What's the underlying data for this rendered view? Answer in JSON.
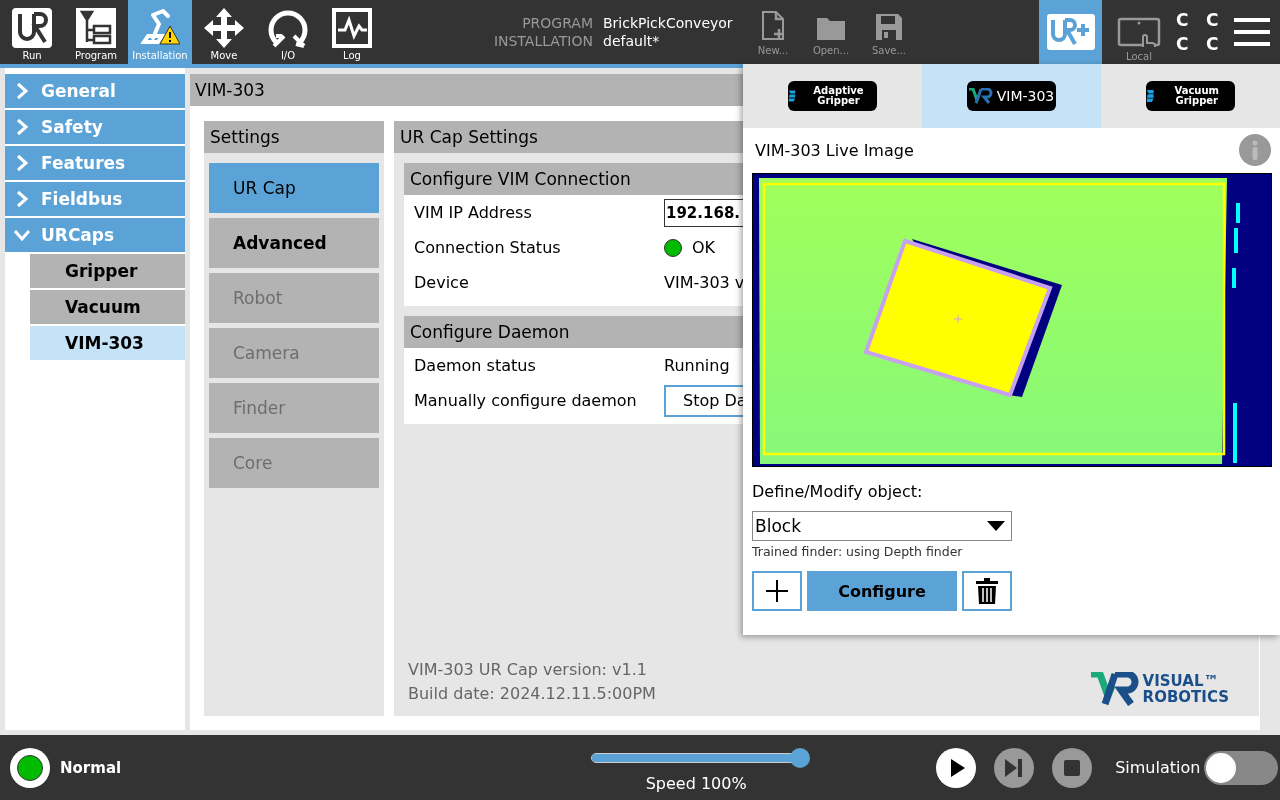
{
  "top_nav": [
    {
      "label": "Run",
      "kind": "run",
      "selected": false
    },
    {
      "label": "Program",
      "kind": "program",
      "selected": false
    },
    {
      "label": "Installation",
      "kind": "installation",
      "selected": true
    },
    {
      "label": "Move",
      "kind": "move",
      "selected": false
    },
    {
      "label": "I/O",
      "kind": "io",
      "selected": false
    },
    {
      "label": "Log",
      "kind": "log",
      "selected": false
    }
  ],
  "program_info": {
    "program_label": "PROGRAM",
    "program_name": "BrickPickConveyor",
    "installation_label": "INSTALLATION",
    "installation_name": "default*"
  },
  "file_buttons": [
    {
      "label": "New...",
      "kind": "new"
    },
    {
      "label": "Open...",
      "kind": "open"
    },
    {
      "label": "Save...",
      "kind": "save"
    }
  ],
  "urcaps_button": {
    "selected": true
  },
  "local_button": {
    "label": "Local"
  },
  "mode_letters": [
    "C",
    "C",
    "C",
    "C"
  ],
  "sidebar": {
    "items": [
      {
        "label": "General",
        "expanded": false
      },
      {
        "label": "Safety",
        "expanded": false
      },
      {
        "label": "Features",
        "expanded": false
      },
      {
        "label": "Fieldbus",
        "expanded": false
      },
      {
        "label": "URCaps",
        "expanded": true,
        "children": [
          {
            "label": "Gripper",
            "selected": false
          },
          {
            "label": "Vacuum",
            "selected": false
          },
          {
            "label": "VIM-303",
            "selected": true
          }
        ]
      }
    ]
  },
  "page_title": "VIM-303",
  "settings": {
    "title": "Settings",
    "items": [
      {
        "label": "UR Cap",
        "selected": true,
        "disabled": false
      },
      {
        "label": "Advanced",
        "selected": false,
        "disabled": false
      },
      {
        "label": "Robot",
        "selected": false,
        "disabled": true
      },
      {
        "label": "Camera",
        "selected": false,
        "disabled": true
      },
      {
        "label": "Finder",
        "selected": false,
        "disabled": true
      },
      {
        "label": "Core",
        "selected": false,
        "disabled": true
      }
    ]
  },
  "urcap_settings": {
    "title": "UR Cap Settings",
    "sections": [
      {
        "title": "Configure VIM Connection",
        "rows": [
          {
            "label": "VIM IP Address",
            "kind": "field",
            "value": "192.168."
          },
          {
            "label": "Connection Status",
            "kind": "status",
            "value": "OK",
            "color": "#00bb00"
          },
          {
            "label": "Device",
            "kind": "text",
            "value": "VIM-303 v"
          }
        ]
      },
      {
        "title": "Configure Daemon",
        "rows": [
          {
            "label": "Daemon status",
            "kind": "text",
            "value": "Running"
          },
          {
            "label": "Manually configure daemon",
            "kind": "button",
            "value": "Stop Da"
          }
        ]
      }
    ],
    "version": "VIM-303 UR Cap version:  v1.1",
    "build_date": "Build date:  2024.12.11.5:00PM",
    "logo_words": [
      "VISUAL™",
      "ROBOTICS"
    ]
  },
  "urcap_panel": {
    "tabs": [
      {
        "label": "Adaptive Gripper",
        "kind": "gripper",
        "selected": false
      },
      {
        "label": "VIM-303",
        "kind": "vr",
        "selected": true
      },
      {
        "label": "Vacuum Gripper",
        "kind": "gripper",
        "selected": false
      }
    ],
    "title": "VIM-303 Live Image",
    "define_label": "Define/Modify object:",
    "object_select": {
      "value": "Block"
    },
    "finder_note": "Trained finder: using Depth finder",
    "buttons": [
      {
        "kind": "add"
      },
      {
        "kind": "configure",
        "label": "Configure"
      },
      {
        "kind": "delete"
      }
    ]
  },
  "footer": {
    "robot_status": {
      "label": "Normal",
      "color": "#00bb00"
    },
    "speed": {
      "level": 1,
      "label": "Speed 100%"
    },
    "controls": [
      {
        "kind": "play",
        "disabled": false
      },
      {
        "kind": "step",
        "disabled": true
      },
      {
        "kind": "stop",
        "disabled": true
      }
    ],
    "simulation": {
      "label": "Simulation",
      "on": false
    }
  }
}
